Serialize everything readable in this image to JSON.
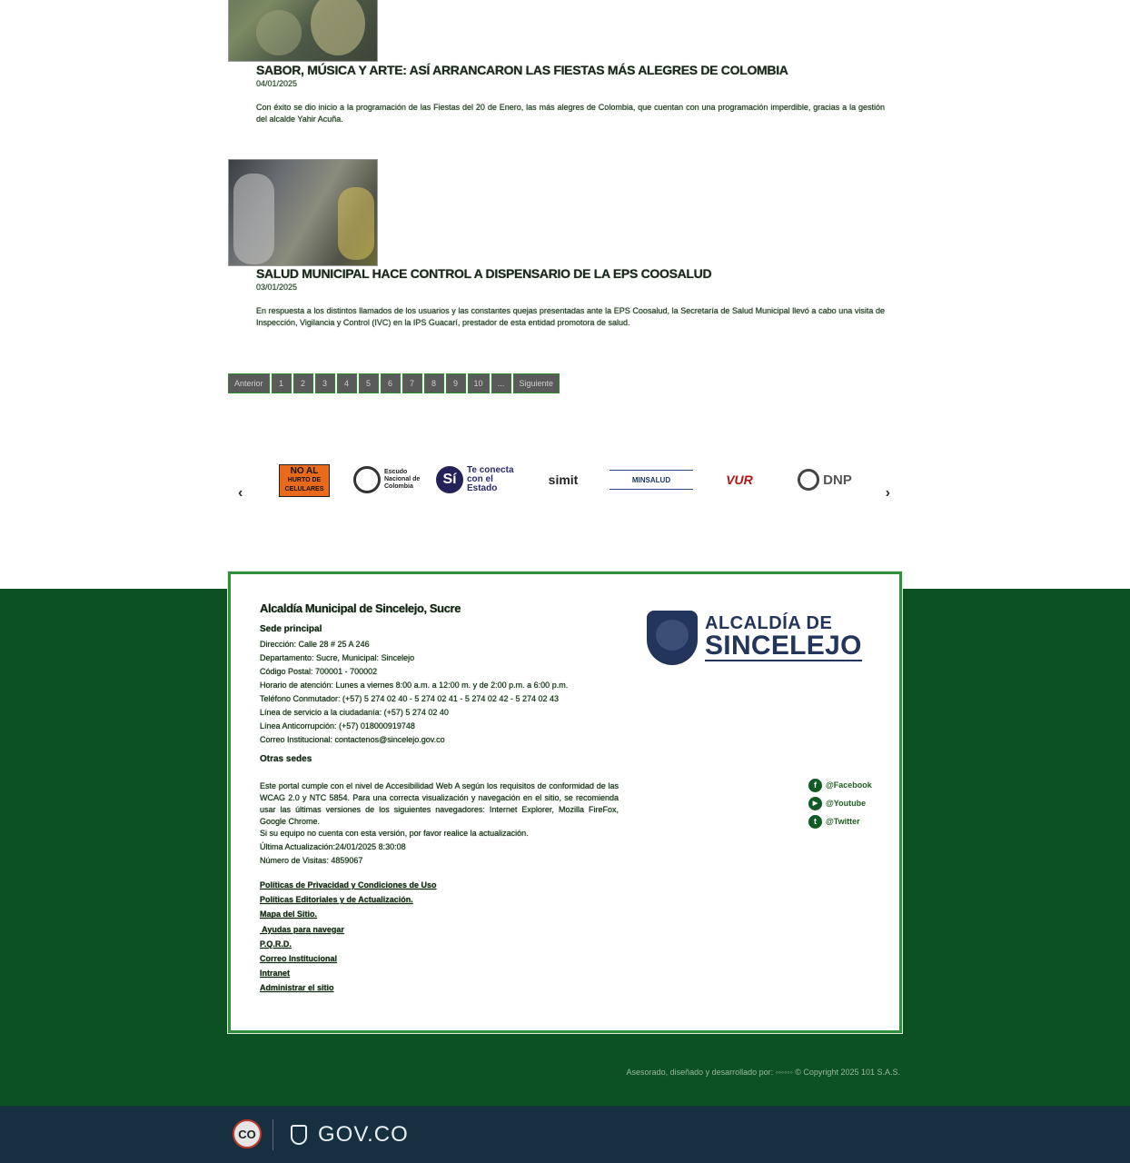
{
  "news": [
    {
      "title": "SABOR, MÚSICA Y ARTE: ASÍ ARRANCARON LAS FIESTAS MÁS ALEGRES DE COLOMBIA",
      "date": "04/01/2025",
      "description": "Con éxito se dio inicio a la programación de las Fiestas del 20 de Enero, las más alegres de Colombia, que cuentan con una programación imperdible, gracias a la gestión del alcalde Yahir Acuña."
    },
    {
      "title": "SALUD MUNICIPAL HACE CONTROL A DISPENSARIO DE LA EPS COOSALUD",
      "date": "03/01/2025",
      "description": "En respuesta a los distintos llamados de los usuarios y las constantes quejas presentadas ante la EPS Coosalud, la Secretaría de Salud Municipal llevó a cabo una visita de Inspección, Vigilancia y Control (IVC) en la IPS Guacarí, prestador de esta entidad promotora de salud."
    }
  ],
  "pagination": {
    "prev": "Anterior",
    "pages": [
      "1",
      "2",
      "3",
      "4",
      "5",
      "6",
      "7",
      "8",
      "9",
      "10",
      "..."
    ],
    "next": "Siguiente"
  },
  "carousel": {
    "prev_icon": "chevron-left-icon",
    "next_icon": "chevron-right-icon",
    "logos": {
      "noal_1": "NO AL",
      "noal_2": "HURTO DE",
      "noal_3": "CELULARES",
      "escudo": "Escudo Nacional de Colombia",
      "si_mark": "Sí",
      "si_text": "Te conecta con el Estado",
      "simit": "simit",
      "minsalud": "MINSALUD",
      "vur": "VUR",
      "dnp": "DNP"
    }
  },
  "footer": {
    "title": "Alcaldía Municipal de Sincelejo, Sucre",
    "sede": "Sede principal",
    "lines": [
      "Dirección: Calle 28 # 25 A 246",
      "Departamento: Sucre, Municipal: Sincelejo",
      "Código Postal: 700001 - 700002",
      "Horario de atención: Lunes a viernes 8:00 a.m. a 12:00 m. y de 2:00 p.m. a 6:00 p.m.",
      "Teléfono Conmutador: (+57) 5 274 02 40 - 5 274 02 41 - 5 274 02 42 - 5 274 02 43",
      "Línea de servicio a la ciudadanía: (+57) 5 274 02 40",
      "Línea Anticorrupción: (+57) 018000919748",
      "Correo Institucional: contactenos@sincelejo.gov.co"
    ],
    "otras_sedes": "Otras sedes",
    "accessibility": "Este portal cumple con el nivel de Accesibilidad Web A según los requisitos de conformidad de las WCAG 2.0 y NTC 5854. Para una correcta visualización y navegación en el sitio, se recomienda usar las últimas versiones de los siguientes navegadores: Internet Explorer, Mozilla FireFox, Google Chrome.",
    "accessibility_2": "Si su equipo no cuenta con esta versión, por favor realice la actualización.",
    "last_update": "Última Actualización:24/01/2025 8:30:08",
    "visits": "Número de Visitas: 4859067",
    "links": [
      "Políticas de Privacidad y Condiciones de Uso",
      "Políticas Editoriales y de Actualización.",
      "Mapa del Sitio.",
      " Ayudas para navegar",
      "P.Q.R.D.",
      "Correo Institucional",
      "Intranet",
      "Administrar el sitio"
    ],
    "brand_top": "ALCALDÍA DE",
    "brand_bottom": "SINCELEJO",
    "social": [
      {
        "icon": "facebook-icon",
        "glyph": "f",
        "label": "@Facebook"
      },
      {
        "icon": "youtube-icon",
        "glyph": "▶",
        "label": "@Youtube"
      },
      {
        "icon": "twitter-icon",
        "glyph": "t",
        "label": "@Twitter"
      }
    ],
    "credit": "Asesorado, diseñado y desarrollado por: ◦◦◦◦◦◦ © Copyright 2025 101 S.A.S."
  },
  "govbar": {
    "badge": "CO",
    "logo_text": "GOV.CO"
  },
  "colors": {
    "footer_green": "#0b5123",
    "card_border": "#2f8f3a",
    "gov_bar": "#163040",
    "brand_navy": "#23355a"
  }
}
